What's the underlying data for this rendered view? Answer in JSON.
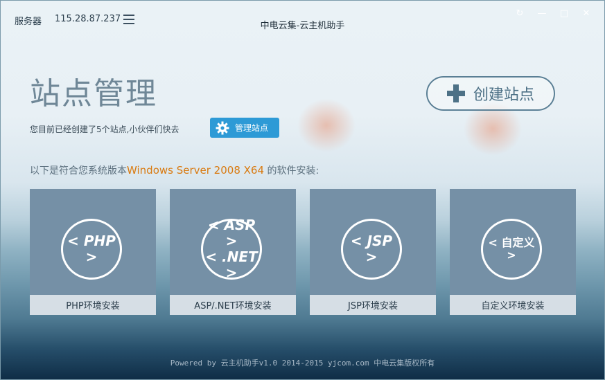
{
  "header": {
    "server_label": "服务器",
    "server_ip": "115.28.87.237",
    "title": "中电云集-云主机助手"
  },
  "window_controls": {
    "refresh": "↻",
    "minimize": "—",
    "maximize": "□",
    "close": "✕"
  },
  "main": {
    "page_title": "站点管理",
    "create_label": "创建站点",
    "site_info": "您目前已经创建了5个站点,小伙伴们快去",
    "manage_label": "管理站点",
    "os_prefix": "以下是符合您系统版本",
    "os_name": "Windows Server 2008 X64",
    "os_suffix": " 的软件安装:"
  },
  "cards": [
    {
      "icon_text": "< PHP >",
      "caption": "PHP环境安装",
      "icon": "php-icon"
    },
    {
      "icon_line1": "< ASP >",
      "icon_line2": "< .NET >",
      "caption": "ASP/.NET环境安装",
      "icon": "aspnet-icon"
    },
    {
      "icon_text": "< JSP >",
      "caption": "JSP环境安装",
      "icon": "jsp-icon"
    },
    {
      "icon_text": "< 自定义 >",
      "caption": "自定义环境安装",
      "icon": "custom-icon"
    }
  ],
  "footer": {
    "text": "Powered by 云主机助手v1.0  2014-2015 yjcom.com 中电云集版权所有"
  },
  "colors": {
    "accent_blue": "#2d9ad6",
    "os_highlight": "#d97a10",
    "card_bg": "#7590a6"
  }
}
